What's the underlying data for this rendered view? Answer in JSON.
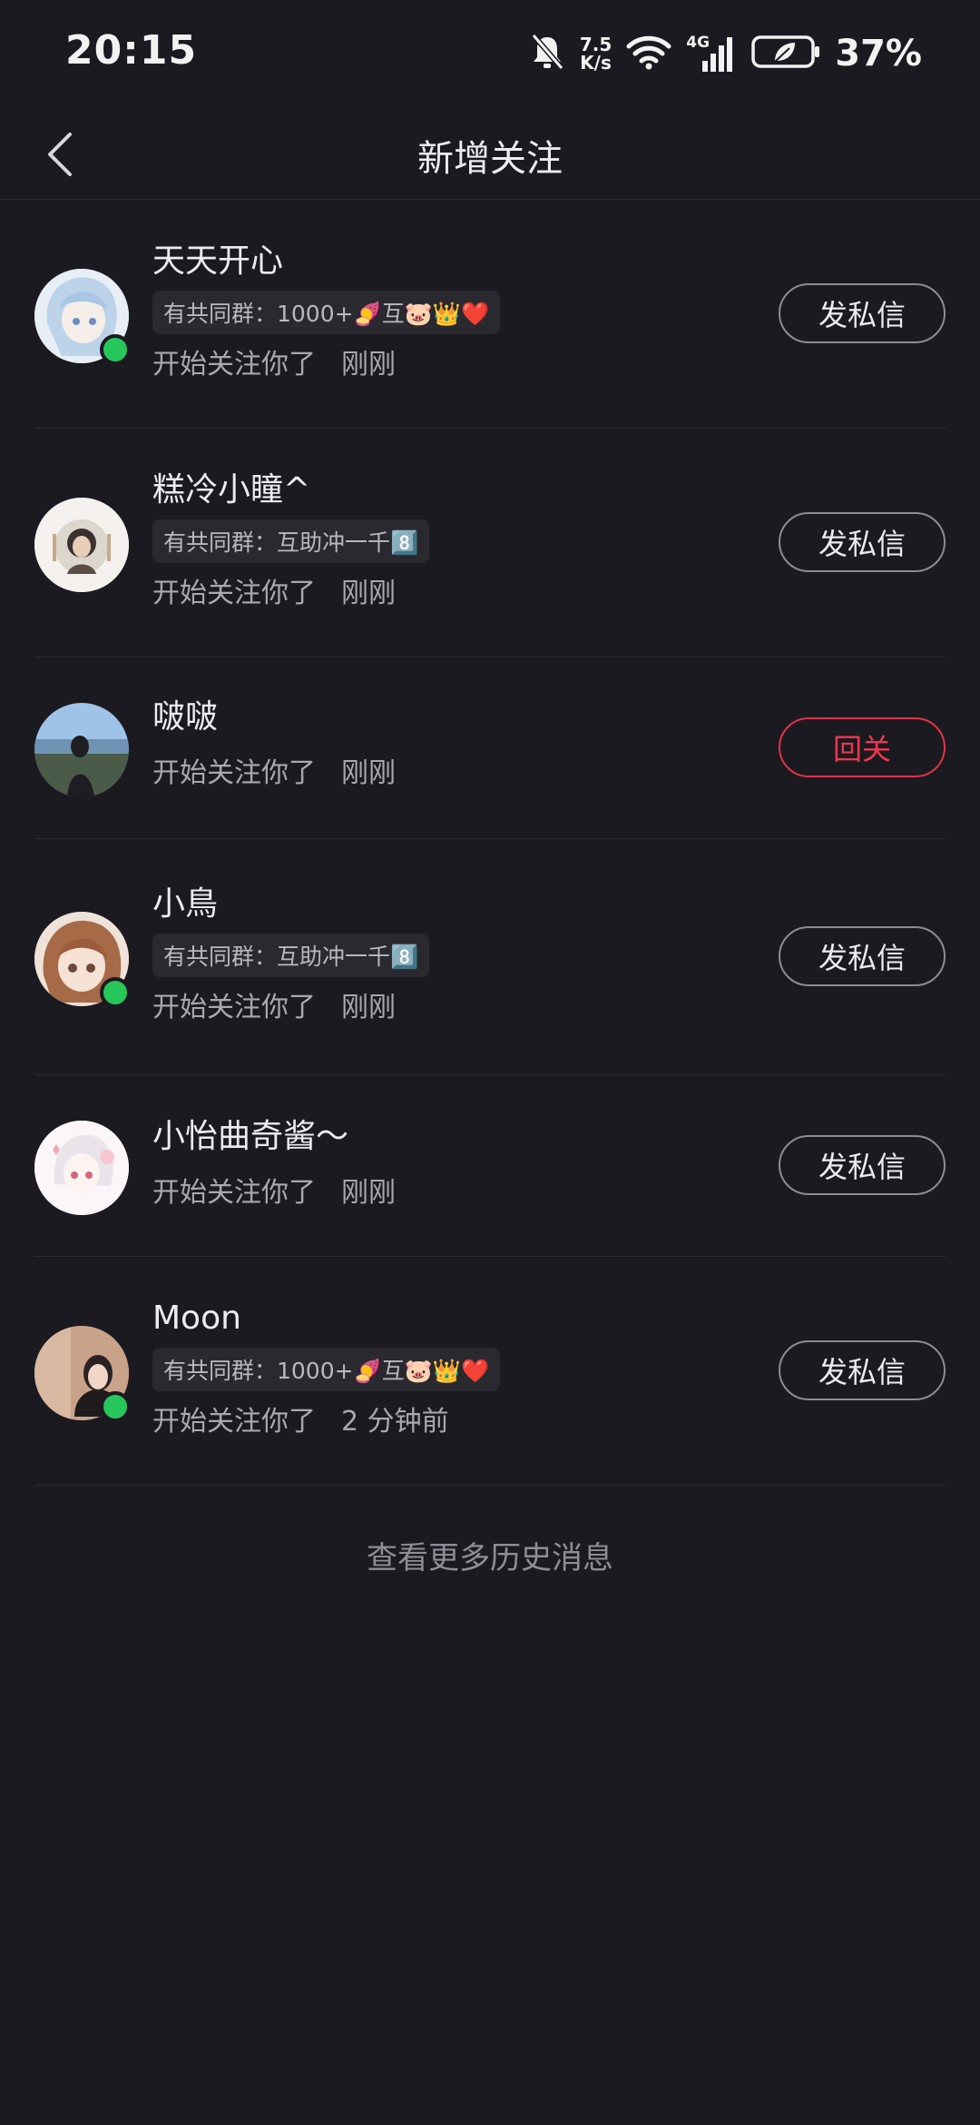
{
  "status_bar": {
    "time": "20:15",
    "net_speed_value": "7.5",
    "net_speed_unit": "K/s",
    "network_type": "4G",
    "battery_percent": "37%"
  },
  "header": {
    "title": "新增关注"
  },
  "items": [
    {
      "name": "天天开心",
      "group": "有共同群：1000+🍠互🐷👑❤️",
      "action": "开始关注你了",
      "time": "刚刚",
      "button": "发私信",
      "online": true
    },
    {
      "name": "糕冷小瞳^",
      "group": "有共同群：互助冲一千8️⃣",
      "action": "开始关注你了",
      "time": "刚刚",
      "button": "发私信",
      "online": false
    },
    {
      "name": "啵啵",
      "action": "开始关注你了",
      "time": "刚刚",
      "button": "回关",
      "online": false
    },
    {
      "name": "小鳥",
      "group": "有共同群：互助冲一千8️⃣",
      "action": "开始关注你了",
      "time": "刚刚",
      "button": "发私信",
      "online": true
    },
    {
      "name": "小怡曲奇酱～",
      "action": "开始关注你了",
      "time": "刚刚",
      "button": "发私信",
      "online": false
    },
    {
      "name": "Moon",
      "group": "有共同群：1000+🍠互🐷👑❤️",
      "action": "开始关注你了",
      "time": "2 分钟前",
      "button": "发私信",
      "online": true
    }
  ],
  "footer": {
    "more_history": "查看更多历史消息"
  },
  "colors": {
    "background": "#1b1a20",
    "online_dot": "#27c65b",
    "follow_back_accent": "#f0384f"
  }
}
